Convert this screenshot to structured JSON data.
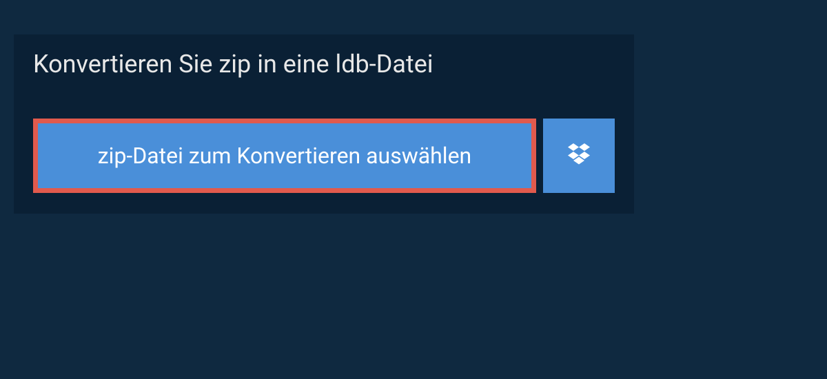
{
  "heading": "Konvertieren Sie zip in eine ldb-Datei",
  "selectButton": {
    "label": "zip-Datei zum Konvertieren auswählen"
  },
  "dropboxButton": {
    "iconName": "dropbox-icon"
  },
  "colors": {
    "pageBg": "#0f2940",
    "panelBg": "#0a2035",
    "buttonBg": "#4a8fd9",
    "highlightBorder": "#e15a4d",
    "textLight": "#e8e8e8"
  }
}
